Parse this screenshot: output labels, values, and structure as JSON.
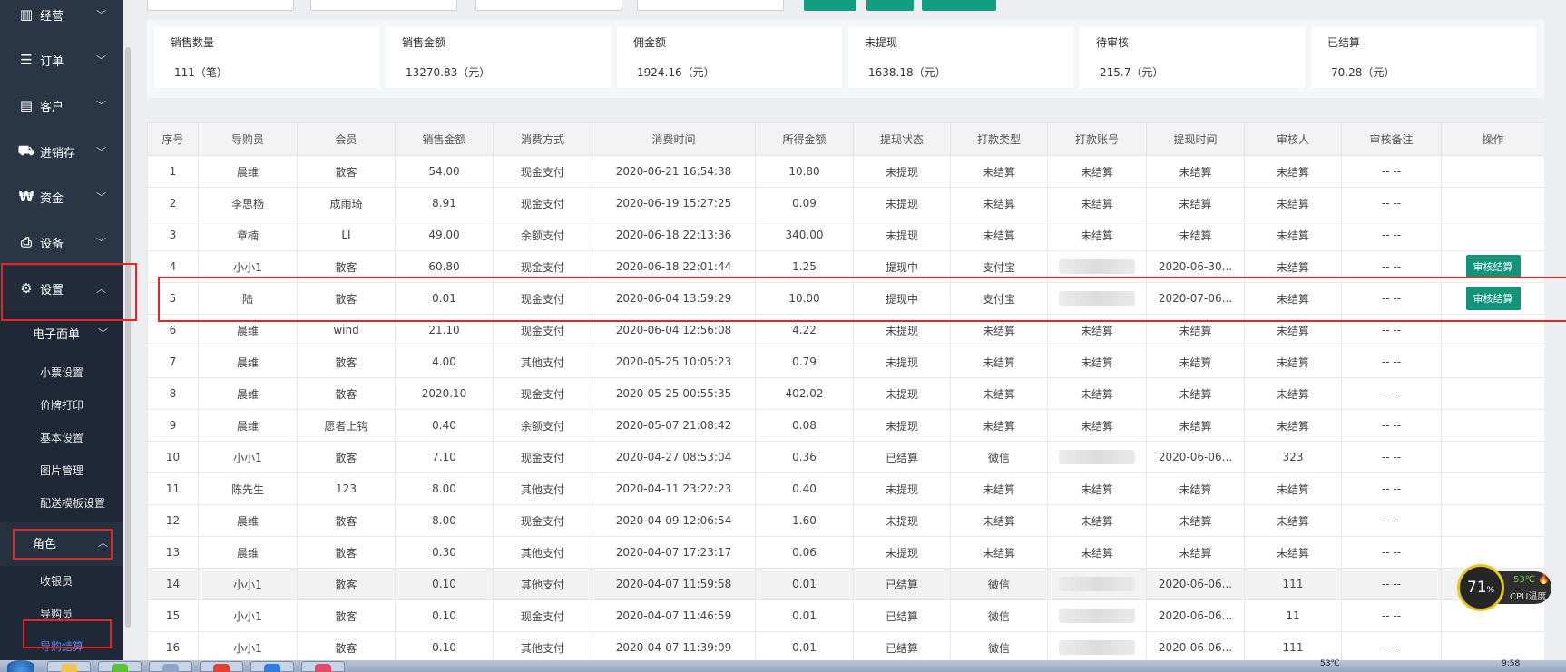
{
  "sidebar": {
    "menu": [
      {
        "label": "经营",
        "icon": "bar-chart-icon"
      },
      {
        "label": "订单",
        "icon": "list-icon"
      },
      {
        "label": "客户",
        "icon": "id-card-icon"
      },
      {
        "label": "进销存",
        "icon": "truck-icon"
      },
      {
        "label": "资金",
        "icon": "won-icon"
      },
      {
        "label": "设备",
        "icon": "printer-icon"
      },
      {
        "label": "设置",
        "icon": "gear-icon"
      }
    ],
    "submenu": {
      "group_label": "电子面单",
      "items": [
        "小票设置",
        "价牌打印",
        "基本设置",
        "图片管理",
        "配送模板设置"
      ],
      "role_label": "角色",
      "role_items": [
        "收银员",
        "导购员",
        "导购结算"
      ]
    }
  },
  "summary": [
    {
      "title": "销售数量",
      "value": "111（笔）"
    },
    {
      "title": "销售金额",
      "value": "13270.83（元）"
    },
    {
      "title": "佣金额",
      "value": "1924.16（元）"
    },
    {
      "title": "未提现",
      "value": "1638.18（元）"
    },
    {
      "title": "待审核",
      "value": "215.7（元）"
    },
    {
      "title": "已结算",
      "value": "70.28（元）"
    }
  ],
  "table": {
    "headers": [
      "序号",
      "导购员",
      "会员",
      "销售金额",
      "消费方式",
      "消费时间",
      "所得金额",
      "提现状态",
      "打款类型",
      "打款账号",
      "提现时间",
      "审核人",
      "审核备注",
      "操作"
    ],
    "action_label": "审核结算",
    "rows": [
      [
        "1",
        "晨维",
        "散客",
        "54.00",
        "现金支付",
        "2020-06-21 16:54:38",
        "10.80",
        "未提现",
        "未结算",
        "未结算",
        "未结算",
        "未结算",
        "-- --",
        ""
      ],
      [
        "2",
        "李思杨",
        "成雨琦",
        "8.91",
        "现金支付",
        "2020-06-19 15:27:25",
        "0.09",
        "未提现",
        "未结算",
        "未结算",
        "未结算",
        "未结算",
        "-- --",
        ""
      ],
      [
        "3",
        "章楠",
        "LI",
        "49.00",
        "余额支付",
        "2020-06-18 22:13:36",
        "340.00",
        "未提现",
        "未结算",
        "未结算",
        "未结算",
        "未结算",
        "-- --",
        ""
      ],
      [
        "4",
        "小小1",
        "散客",
        "60.80",
        "现金支付",
        "2020-06-18 22:01:44",
        "1.25",
        "提现中",
        "支付宝",
        "",
        "2020-06-30...",
        "未结算",
        "-- --",
        "审核结算"
      ],
      [
        "5",
        "陆",
        "散客",
        "0.01",
        "现金支付",
        "2020-06-04 13:59:29",
        "10.00",
        "提现中",
        "支付宝",
        "",
        "2020-07-06...",
        "未结算",
        "-- --",
        "审核结算"
      ],
      [
        "6",
        "晨维",
        "wind",
        "21.10",
        "现金支付",
        "2020-06-04 12:56:08",
        "4.22",
        "未提现",
        "未结算",
        "未结算",
        "未结算",
        "未结算",
        "-- --",
        ""
      ],
      [
        "7",
        "晨维",
        "散客",
        "4.00",
        "其他支付",
        "2020-05-25 10:05:23",
        "0.79",
        "未提现",
        "未结算",
        "未结算",
        "未结算",
        "未结算",
        "-- --",
        ""
      ],
      [
        "8",
        "晨维",
        "散客",
        "2020.10",
        "现金支付",
        "2020-05-25 00:55:35",
        "402.02",
        "未提现",
        "未结算",
        "未结算",
        "未结算",
        "未结算",
        "-- --",
        ""
      ],
      [
        "9",
        "晨维",
        "愿者上钩",
        "0.40",
        "余额支付",
        "2020-05-07 21:08:42",
        "0.08",
        "未提现",
        "未结算",
        "未结算",
        "未结算",
        "未结算",
        "-- --",
        ""
      ],
      [
        "10",
        "小小1",
        "散客",
        "7.10",
        "现金支付",
        "2020-04-27 08:53:04",
        "0.36",
        "已结算",
        "微信",
        "",
        "2020-06-06...",
        "323",
        "-- --",
        ""
      ],
      [
        "11",
        "陈先生",
        "123",
        "8.00",
        "其他支付",
        "2020-04-11 23:22:23",
        "0.40",
        "未提现",
        "未结算",
        "未结算",
        "未结算",
        "未结算",
        "-- --",
        ""
      ],
      [
        "12",
        "晨维",
        "散客",
        "8.00",
        "现金支付",
        "2020-04-09 12:06:54",
        "1.60",
        "未提现",
        "未结算",
        "未结算",
        "未结算",
        "未结算",
        "-- --",
        ""
      ],
      [
        "13",
        "晨维",
        "散客",
        "0.30",
        "其他支付",
        "2020-04-07 17:23:17",
        "0.06",
        "未提现",
        "未结算",
        "未结算",
        "未结算",
        "未结算",
        "-- --",
        ""
      ],
      [
        "14",
        "小小1",
        "散客",
        "0.10",
        "其他支付",
        "2020-04-07 11:59:58",
        "0.01",
        "已结算",
        "微信",
        "",
        "2020-06-06...",
        "111",
        "-- --",
        ""
      ],
      [
        "15",
        "小小1",
        "散客",
        "0.10",
        "现金支付",
        "2020-04-07 11:46:59",
        "0.01",
        "已结算",
        "微信",
        "",
        "2020-06-06...",
        "11",
        "-- --",
        ""
      ],
      [
        "16",
        "小小1",
        "散客",
        "0.10",
        "其他支付",
        "2020-04-07 11:39:09",
        "0.01",
        "已结算",
        "微信",
        "",
        "2020-06-06...",
        "111",
        "-- --",
        ""
      ]
    ]
  },
  "cpu_widget": {
    "percent": "71",
    "percent_unit": "%",
    "temp": "53℃",
    "label": "CPU温度"
  },
  "taskbar": {
    "temp": "53℃",
    "time": "9:58"
  },
  "colors": {
    "sidebar": "#2a3546",
    "accent": "#129e80",
    "highlight": "#e82424"
  }
}
